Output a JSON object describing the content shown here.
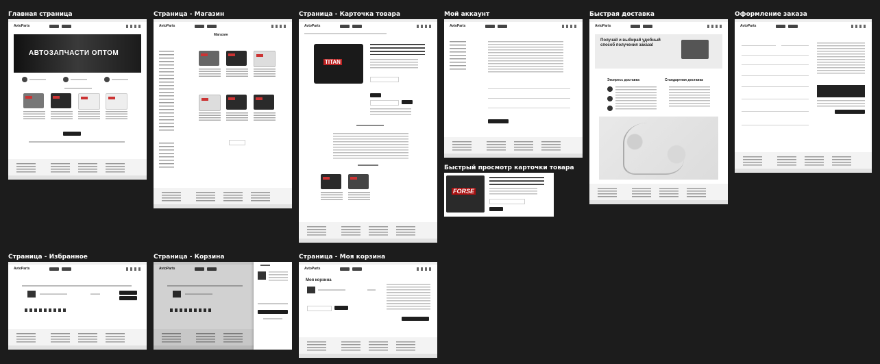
{
  "frames": {
    "home": {
      "title": "Главная страница",
      "hero": "АВТОЗАПЧАСТИ ОПТОМ",
      "logo": "AvtoParts"
    },
    "shop": {
      "title": "Страница - Магазин",
      "heading": "Магазин",
      "logo": "AvtoParts"
    },
    "product": {
      "title": "Страница - Карточка товара",
      "brand": "TITAN",
      "logo": "AvtoParts"
    },
    "account": {
      "title": "Мой аккаунт",
      "logo": "AvtoParts"
    },
    "quickview": {
      "title": "Быстрый просмотр карточки товара",
      "brand": "FORSE"
    },
    "delivery": {
      "title": "Быстрая доставка",
      "hero": "Получай и выбирай удобный способ получения заказа!",
      "express": "Экспресс доставка",
      "standard": "Стандартная доставка",
      "logo": "AvtoParts"
    },
    "checkout": {
      "title": "Оформление заказа",
      "logo": "AvtoParts"
    },
    "favorites": {
      "title": "Страница - Избранное",
      "logo": "AvtoParts"
    },
    "cart": {
      "title": "Страница - Корзина",
      "logo": "AvtoParts"
    },
    "mycart": {
      "title": "Страница - Моя корзина",
      "heading": "Моя корзина",
      "logo": "AvtoParts"
    }
  },
  "colors": {
    "canvas": "#1c1c1c",
    "page": "#ffffff",
    "accent": "#222222"
  }
}
